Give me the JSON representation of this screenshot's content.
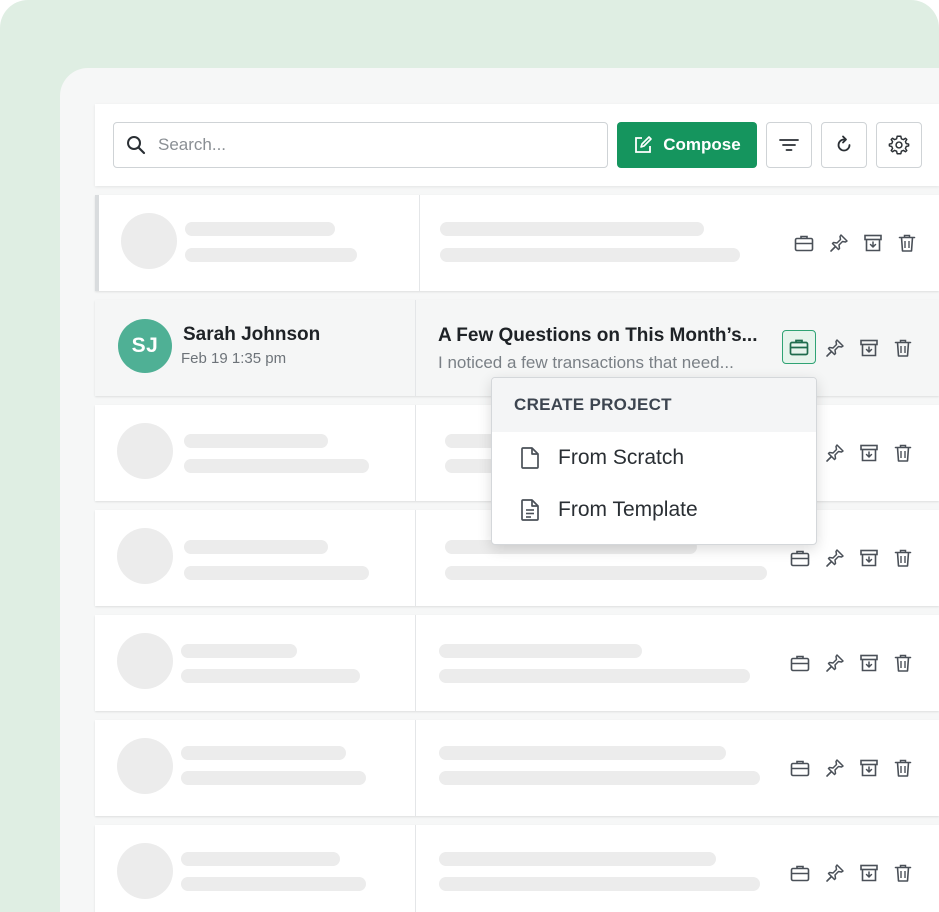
{
  "toolbar": {
    "search_placeholder": "Search...",
    "compose_label": "Compose",
    "icons": [
      "search-icon",
      "compose-icon",
      "filter-icon",
      "refresh-icon",
      "settings-icon"
    ]
  },
  "email": {
    "avatar_initials": "SJ",
    "sender": "Sarah Johnson",
    "date": "Feb 19 1:35 pm",
    "subject": "A Few Questions on This Month’s...",
    "preview": "I noticed a few transactions that need..."
  },
  "row_actions": [
    "briefcase-icon",
    "pin-icon",
    "archive-icon",
    "trash-icon"
  ],
  "dropdown": {
    "header": "CREATE PROJECT",
    "items": [
      {
        "label": "From Scratch",
        "icon": "blank-file-icon"
      },
      {
        "label": "From Template",
        "icon": "template-file-icon"
      }
    ]
  },
  "colors": {
    "brand_green": "#15955e",
    "avatar_green": "#4fb095",
    "background_tint": "#dfeee3"
  }
}
